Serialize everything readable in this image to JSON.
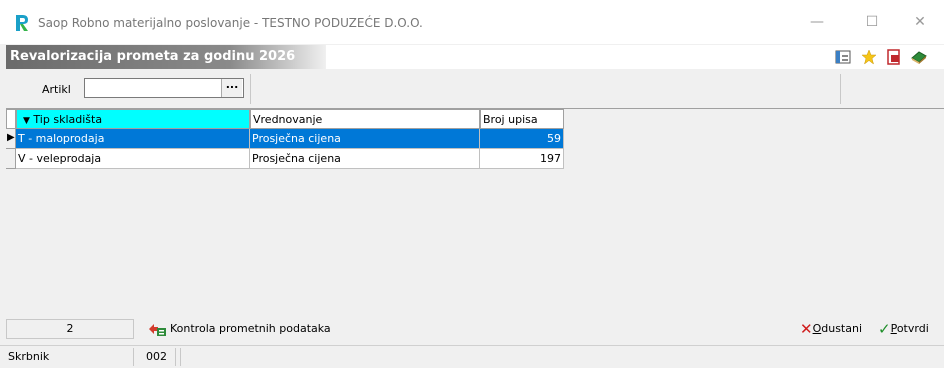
{
  "window": {
    "title": "Saop Robno materijalno poslovanje - TESTNO PODUZEĆE D.O.O.",
    "minimize_glyph": "—",
    "maximize_glyph": "☐",
    "close_glyph": "✕"
  },
  "form": {
    "title": "Revalorizacija prometa za godinu 2026",
    "toolbar_icons": [
      "window-icon",
      "star-icon",
      "document-icon",
      "book-icon"
    ]
  },
  "filter": {
    "artikl_label": "Artikl",
    "artikl_value": "",
    "browse_label": "..."
  },
  "grid": {
    "columns": [
      {
        "label": "Tip skladišta",
        "sorted": true
      },
      {
        "label": "Vrednovanje"
      },
      {
        "label": "Broj upisa"
      }
    ],
    "rows": [
      {
        "tip": "T - maloprodaja",
        "vrednovanje": "Prosječna cijena",
        "broj": "59",
        "selected": true
      },
      {
        "tip": "V - veleprodaja",
        "vrednovanje": "Prosječna cijena",
        "broj": "197",
        "selected": false
      }
    ],
    "sort_glyph": "▼",
    "row_marker": "▶"
  },
  "bottom": {
    "count": "2",
    "kontrola_label": "Kontrola prometnih podataka",
    "odustani_label": "Odustani",
    "odustani_hotkey": "O",
    "odustani_rest": "dustani",
    "potvrdi_hotkey": "P",
    "potvrdi_rest": "otvrdi"
  },
  "status": {
    "user_label": "Skrbnik",
    "code": "002"
  },
  "colors": {
    "selection": "#0078d7",
    "sorted_header": "#00ffff",
    "title_gradient": "#6b6b6b"
  }
}
